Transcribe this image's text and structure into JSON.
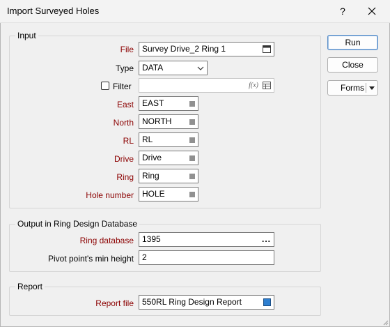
{
  "window": {
    "title": "Import Surveyed Holes",
    "help": "?",
    "close": "✕"
  },
  "input_group": {
    "label": "Input",
    "file_label": "File",
    "file_value": "Survey Drive_2 Ring 1",
    "type_label": "Type",
    "type_value": "DATA",
    "filter_label": "Filter",
    "filter_value": "",
    "filter_fx": "f(x)",
    "east_label": "East",
    "east_value": "EAST",
    "north_label": "North",
    "north_value": "NORTH",
    "rl_label": "RL",
    "rl_value": "RL",
    "drive_label": "Drive",
    "drive_value": "Drive",
    "ring_label": "Ring",
    "ring_value": "Ring",
    "hole_label": "Hole number",
    "hole_value": "HOLE"
  },
  "output_group": {
    "label": "Output in Ring Design Database",
    "ringdb_label": "Ring database",
    "ringdb_value": "1395",
    "ringdb_browse": "...",
    "pivot_label": "Pivot point's min height",
    "pivot_value": "2"
  },
  "report_group": {
    "label": "Report",
    "reportfile_label": "Report file",
    "reportfile_value": "550RL Ring Design Report"
  },
  "buttons": {
    "run": "Run",
    "close": "Close",
    "forms": "Forms"
  },
  "colors": {
    "required_label": "#8b0000",
    "default_button_border": "#5a8ec7"
  },
  "icons": [
    "file-picker-icon",
    "chevron-down-icon",
    "list-icon",
    "table-icon",
    "color-swatch-icon",
    "resize-grip-icon"
  ]
}
